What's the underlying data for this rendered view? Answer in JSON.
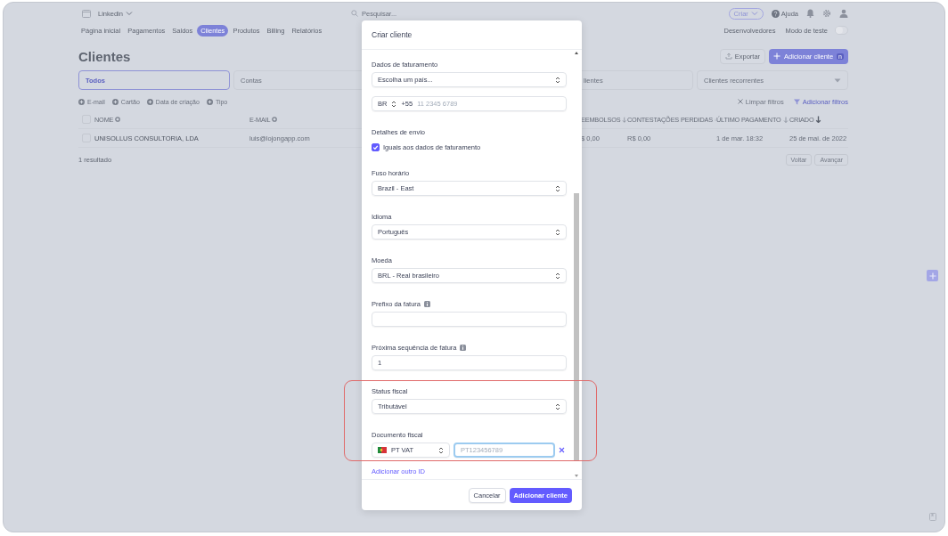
{
  "app": {
    "account": "Linkedin",
    "search": {
      "placeholder": "Pesquisar..."
    },
    "create_button": "Criar",
    "help": "Ajuda",
    "nav": [
      {
        "label": "Página inicial",
        "selected": false
      },
      {
        "label": "Pagamentos",
        "selected": false
      },
      {
        "label": "Saldos",
        "selected": false
      },
      {
        "label": "Clientes",
        "selected": true
      },
      {
        "label": "Produtos",
        "selected": false
      },
      {
        "label": "Billing",
        "selected": false
      },
      {
        "label": "Relatórios",
        "selected": false
      }
    ],
    "developers": "Desenvolvedores",
    "test_mode": {
      "label": "Modo de teste",
      "on": false
    },
    "page_title": "Clientes",
    "export_button": "Exportar",
    "add_button": {
      "label": "Adicionar cliente",
      "shortcut": "n"
    },
    "filter_tabs": [
      {
        "label": "Todos",
        "selected": true
      },
      {
        "label": "Contas",
        "selected": false
      },
      {
        "label": "lientes",
        "selected": false
      },
      {
        "label": "Clientes recorrentes",
        "selected": false
      }
    ],
    "filters": [
      "E-mail",
      "Cartão",
      "Data de criação",
      "Tipo"
    ],
    "clear_filters": "Limpar filtros",
    "add_filters": "Adicionar filtros",
    "table": {
      "columns": [
        {
          "label": "NOME",
          "kind": "settings"
        },
        {
          "label": "E-MAIL",
          "kind": "settings"
        },
        {
          "label": "EEMBOLSOS",
          "kind": "sort"
        },
        {
          "label": "CONTESTAÇÕES PERDIDAS",
          "kind": "sort"
        },
        {
          "label": "ÚLTIMO PAGAMENTO",
          "kind": "sort"
        },
        {
          "label": "CRIADO",
          "kind": "sorted"
        }
      ],
      "select_all_checked": false,
      "rows": [
        {
          "checked": false,
          "cells": [
            "UNISOLLUS CONSULTORIA, LDA",
            "luis@lojongapp.com",
            "$ 0,00",
            "R$ 0,00",
            "1 de mar. 18:32",
            "25 de mai. de 2022"
          ]
        }
      ]
    },
    "result_count": "1 resultado",
    "prev_button": "Voltar",
    "next_button": "Avançar"
  },
  "modal": {
    "title": "Criar cliente",
    "sections": [
      {
        "kind": "select",
        "label": "Dados de faturamento",
        "value": "Escolha um país..."
      },
      {
        "kind": "phone",
        "country": "BR",
        "code": "+55",
        "placeholder": "11 2345 6789"
      },
      {
        "kind": "checkbox",
        "label": "Detalhes de envio",
        "option": "Iguais aos dados de faturamento",
        "checked": true
      },
      {
        "kind": "select",
        "label": "Fuso horário",
        "value": "Brazil - East"
      },
      {
        "kind": "select",
        "label": "Idioma",
        "value": "Português"
      },
      {
        "kind": "select",
        "label": "Moeda",
        "value": "BRL - Real brasileiro"
      },
      {
        "kind": "input",
        "label": "Prefixo da fatura",
        "info": true
      },
      {
        "kind": "input",
        "label": "Próxima sequência de fatura",
        "info": true,
        "value": "1"
      },
      {
        "kind": "select",
        "label": "Status fiscal",
        "value": "Tributável"
      },
      {
        "kind": "tax-id",
        "label": "Documento fiscal",
        "type": "PT VAT",
        "placeholder": "PT123456789",
        "focused": true
      }
    ],
    "link": "Adicionar outro ID",
    "cancel_button": "Cancelar",
    "submit_button": "Adicionar cliente"
  }
}
